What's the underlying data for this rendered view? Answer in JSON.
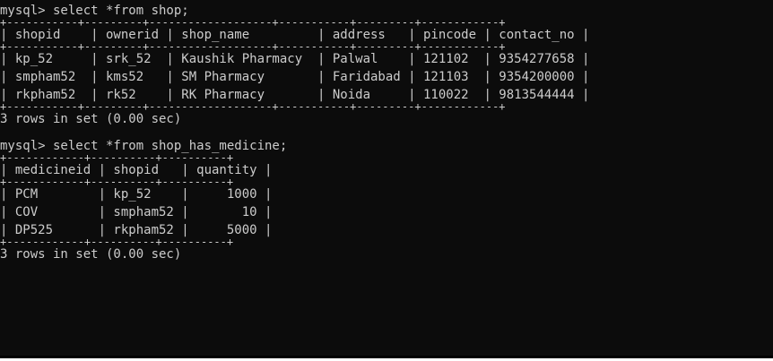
{
  "terminal": {
    "colors": {
      "background": "#0c0c0c",
      "foreground": "#cccccc"
    },
    "lines": [
      {
        "type": "text",
        "text": "mysql> select *from shop;"
      },
      {
        "type": "sep",
        "text": "+-----------+---------+-------------------+-----------+---------+------------+"
      },
      {
        "type": "text",
        "text": "| shopid    | ownerid | shop_name         | address   | pincode | contact_no |"
      },
      {
        "type": "sep",
        "text": "+-----------+---------+-------------------+-----------+---------+------------+"
      },
      {
        "type": "text",
        "text": "| kp_52     | srk_52  | Kaushik Pharmacy  | Palwal    | 121102  | 9354277658 |"
      },
      {
        "type": "text",
        "text": "| smpham52  | kms52   | SM Pharmacy       | Faridabad | 121103  | 9354200000 |"
      },
      {
        "type": "text",
        "text": "| rkpham52  | rk52    | RK Pharmacy       | Noida     | 110022  | 9813544444 |"
      },
      {
        "type": "sep",
        "text": "+-----------+---------+-------------------+-----------+---------+------------+"
      },
      {
        "type": "text",
        "text": "3 rows in set (0.00 sec)"
      },
      {
        "type": "gap",
        "text": ""
      },
      {
        "type": "text",
        "text": "mysql> select *from shop_has_medicine;"
      },
      {
        "type": "sep",
        "text": "+------------+----------+----------+"
      },
      {
        "type": "text",
        "text": "| medicineid | shopid   | quantity |"
      },
      {
        "type": "sep",
        "text": "+------------+----------+----------+"
      },
      {
        "type": "text",
        "text": "| PCM        | kp_52    |     1000 |"
      },
      {
        "type": "text",
        "text": "| COV        | smpham52 |       10 |"
      },
      {
        "type": "text",
        "text": "| DP525      | rkpham52 |     5000 |"
      },
      {
        "type": "sep",
        "text": "+------------+----------+----------+"
      },
      {
        "type": "text",
        "text": "3 rows in set (0.00 sec)"
      }
    ]
  }
}
